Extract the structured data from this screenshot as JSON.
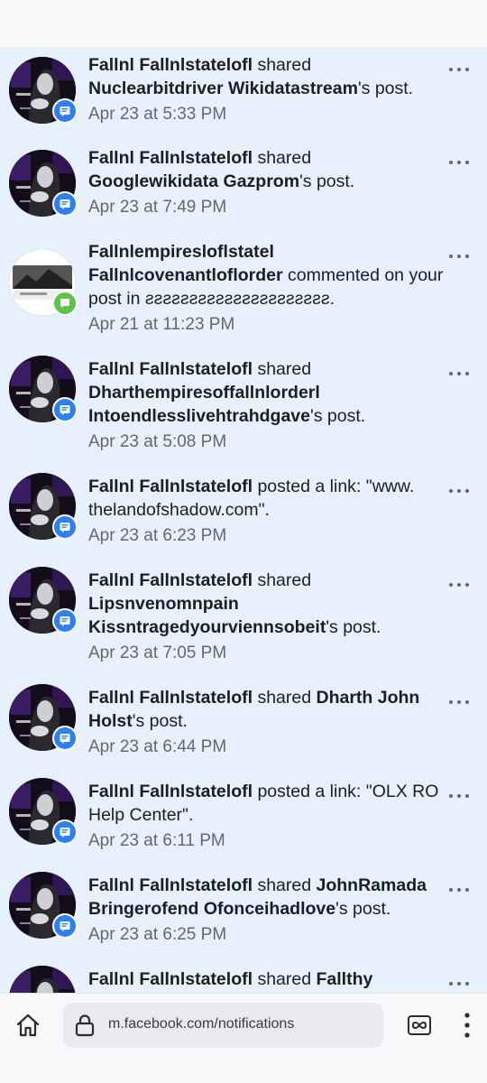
{
  "notifications": [
    {
      "pre": "",
      "actor": "Fallnl Fallnlstatelofl",
      "mid": " shared ",
      "target": "Nuclearbitdriver Wikidatastream",
      "post": "'s post.",
      "time": "Apr 23 at 5:33 PM",
      "badge": "share"
    },
    {
      "pre": "",
      "actor": "Fallnl Fallnlstatelofl",
      "mid": " shared ",
      "target": "Googlewikidata Gazprom",
      "post": "'s post.",
      "time": "Apr 23 at 7:49 PM",
      "badge": "share"
    },
    {
      "pre": "",
      "actor": "Fallnlempiresloflstatel Fallnlcovenantloflorder",
      "mid": " commented on your post in ƨƨƨƨƨƨƨƨƨƨƨƨƨƨƨƨƨƨƨƨƨ.",
      "target": "",
      "post": "",
      "time": "Apr 21 at 11:23 PM",
      "badge": "comment"
    },
    {
      "pre": "",
      "actor": "Fallnl Fallnlstatelofl",
      "mid": " shared ",
      "target": "Dharthempiresoffallnlorderl Intoendlesslivehtrahdgave",
      "post": "'s post.",
      "time": "Apr 23 at 5:08 PM",
      "badge": "share"
    },
    {
      "pre": "",
      "actor": "Fallnl Fallnlstatelofl",
      "mid": " posted a link: \"www. thelandofshadow.com\".",
      "target": "",
      "post": "",
      "time": "Apr 23 at 6:23 PM",
      "badge": "share"
    },
    {
      "pre": "",
      "actor": "Fallnl Fallnlstatelofl",
      "mid": " shared ",
      "target": "Lipsnvenomnpain Kissntragedyourviennsobeit",
      "post": "'s post.",
      "time": "Apr 23 at 7:05 PM",
      "badge": "share"
    },
    {
      "pre": "",
      "actor": "Fallnl Fallnlstatelofl",
      "mid": " shared ",
      "target": "Dharth John Holst",
      "post": "'s post.",
      "time": "Apr 23 at 6:44 PM",
      "badge": "share"
    },
    {
      "pre": "",
      "actor": "Fallnl Fallnlstatelofl",
      "mid": " posted a link: \"OLX RO Help Center\".",
      "target": "",
      "post": "",
      "time": "Apr 23 at 6:11 PM",
      "badge": "share"
    },
    {
      "pre": "",
      "actor": "Fallnl Fallnlstatelofl",
      "mid": " shared ",
      "target": "JohnRamada Bringerofend Ofonceihadlove",
      "post": "'s post.",
      "time": "Apr 23 at 6:25 PM",
      "badge": "share"
    },
    {
      "pre": "",
      "actor": "Fallnl Fallnlstatelofl",
      "mid": " shared ",
      "target": "Fallthy",
      "post": "",
      "time": "",
      "badge": "share"
    }
  ],
  "browser": {
    "url": "m.facebook.com/notifications",
    "icons": {
      "home": "home-icon",
      "lock": "lock-icon",
      "tabs": "infinity-tabs-icon",
      "menu": "vertical-dots-icon"
    }
  },
  "colors": {
    "feed_bg": "#e7f0fd",
    "share_badge": "#2e7ff1",
    "comment_badge": "#5fc24a"
  }
}
